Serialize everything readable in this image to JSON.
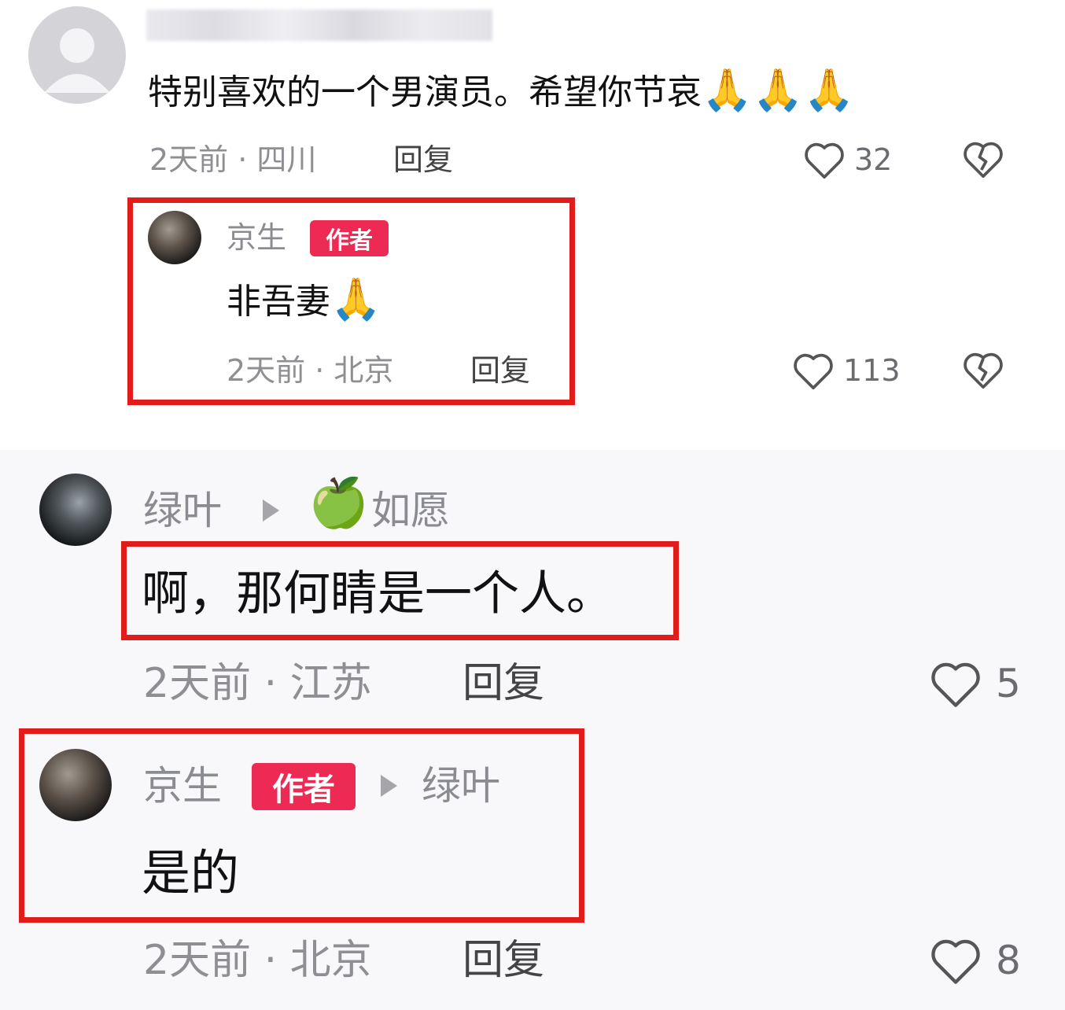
{
  "colors": {
    "author_badge": "#ec2a53",
    "highlight_border": "#e21b1b",
    "muted_text": "#8e8e93"
  },
  "comments": [
    {
      "username_blurred": true,
      "text": "特别喜欢的一个男演员。希望你节哀",
      "emoji": "🙏🙏🙏",
      "time_location": "2天前 · 四川",
      "reply_label": "回复",
      "likes": "32",
      "like_icon": "heart-outline-icon",
      "dislike_icon": "broken-heart-icon",
      "reply": {
        "username": "京生",
        "badge": "作者",
        "text": "非吾妻",
        "emoji": "🙏",
        "time_location": "2天前 · 北京",
        "reply_label": "回复",
        "likes": "113"
      }
    },
    {
      "username": "绿叶",
      "reply_to_emoji": "🍏",
      "reply_to": "如愿",
      "text": "啊，那何睛是一个人。",
      "time_location": "2天前 · 江苏",
      "reply_label": "回复",
      "likes": "5"
    },
    {
      "username": "京生",
      "badge": "作者",
      "reply_to": "绿叶",
      "text": "是的",
      "time_location": "2天前 · 北京",
      "reply_label": "回复",
      "likes": "8"
    }
  ]
}
